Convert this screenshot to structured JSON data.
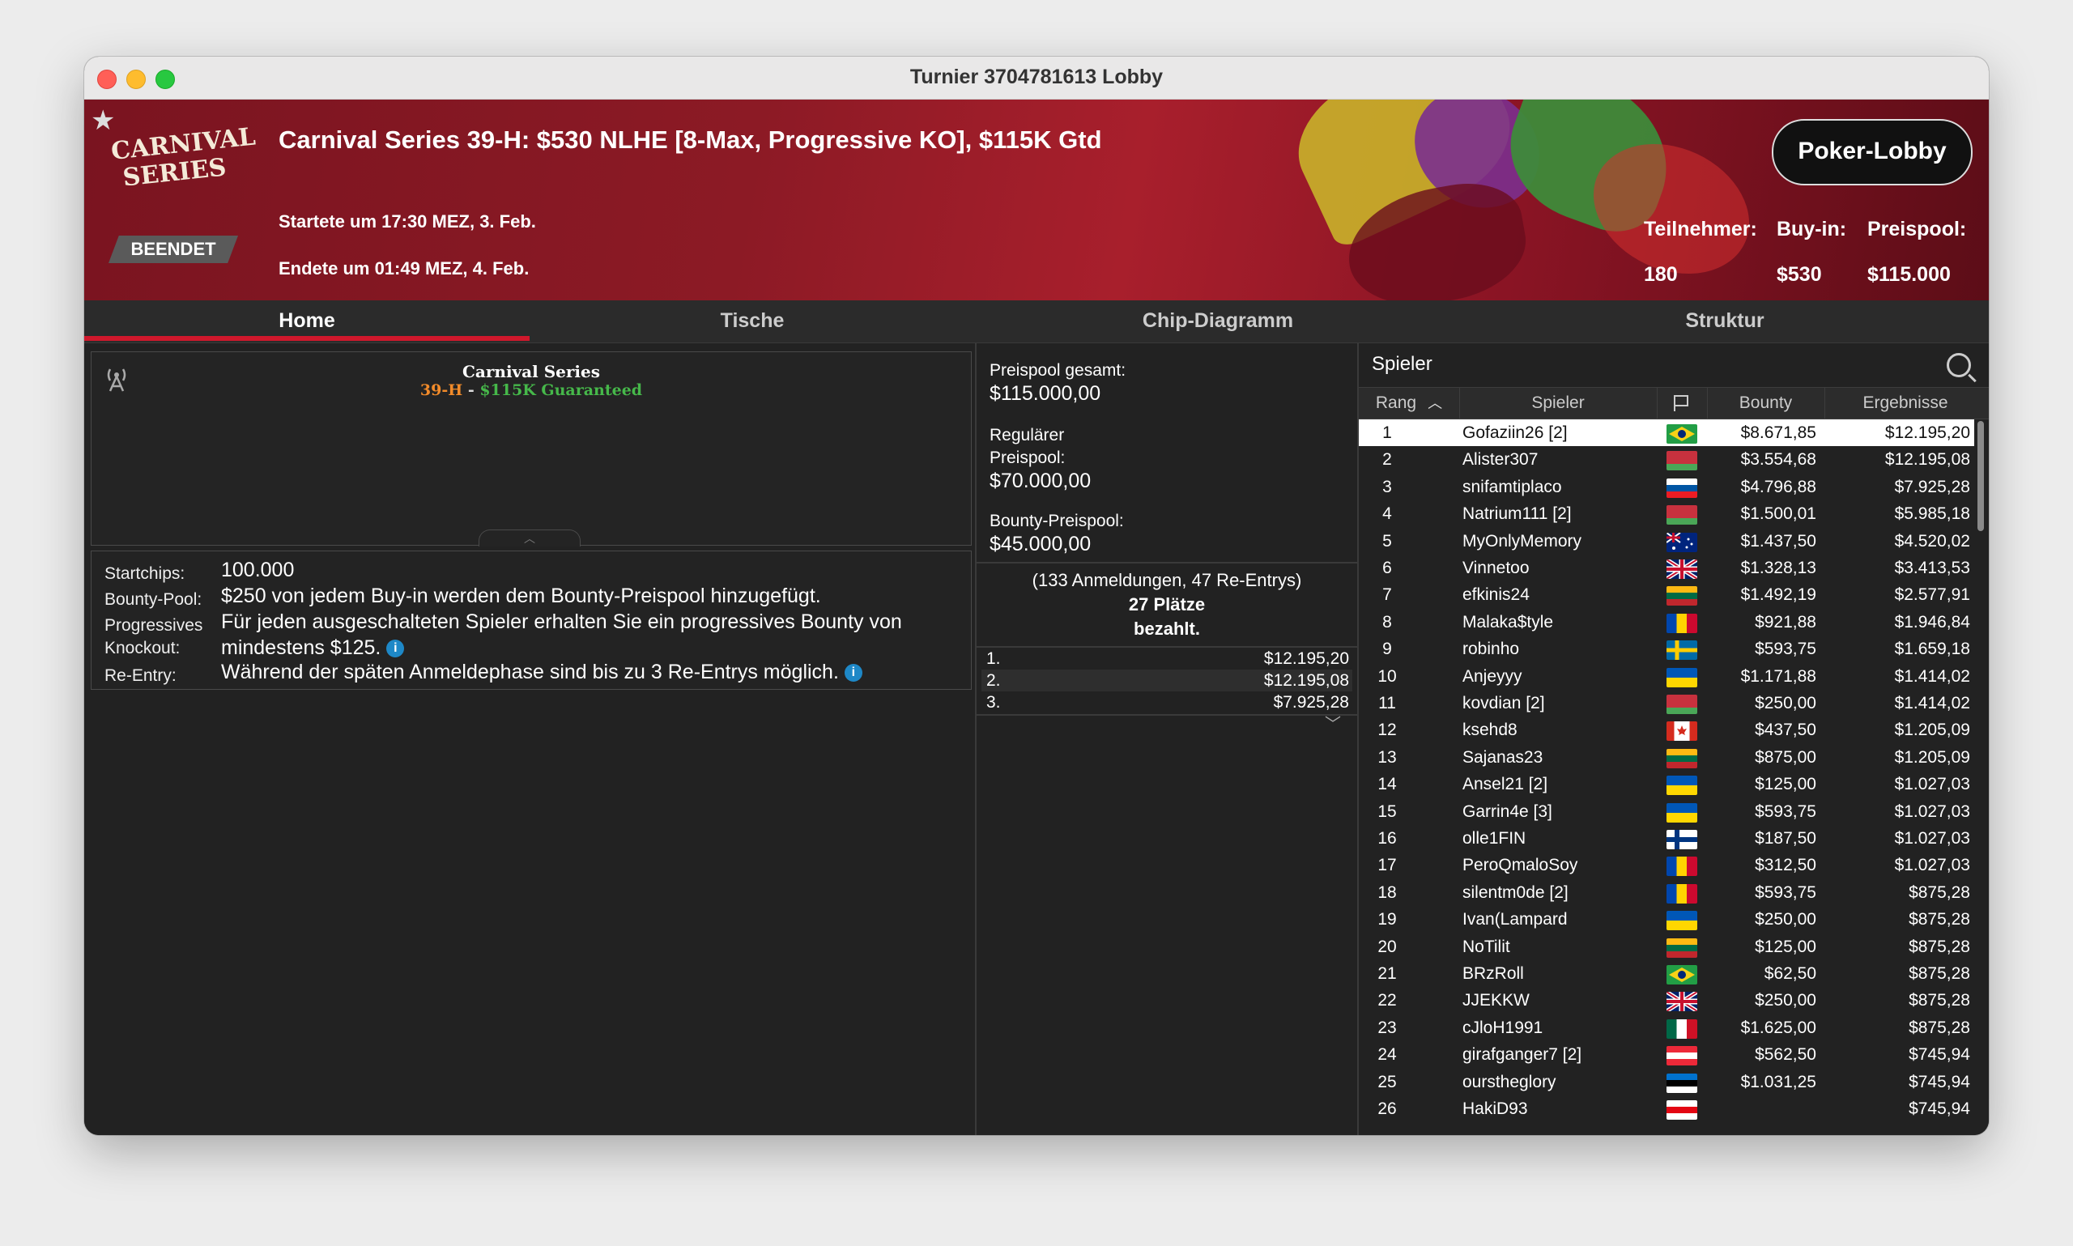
{
  "window": {
    "title": "Turnier 3704781613 Lobby"
  },
  "banner": {
    "logo_line1": "CARNIVAL",
    "logo_line2": "SERIES",
    "status": "BEENDET",
    "title": "Carnival Series 39-H: $530 NLHE [8-Max, Progressive KO], $115K Gtd",
    "started": "Startete um 17:30 MEZ, 3. Feb.",
    "ended": "Endete um 01:49 MEZ, 4. Feb.",
    "lobby_button": "Poker-Lobby",
    "stats": [
      {
        "label": "Teilnehmer:",
        "value": "180"
      },
      {
        "label": "Buy-in:",
        "value": "$530"
      },
      {
        "label": "Preispool:",
        "value": "$115.000"
      }
    ]
  },
  "tabs": [
    {
      "label": "Home",
      "active": true
    },
    {
      "label": "Tische",
      "active": false
    },
    {
      "label": "Chip-Diagramm",
      "active": false
    },
    {
      "label": "Struktur",
      "active": false
    }
  ],
  "home": {
    "banner_title": "Carnival Series",
    "banner_code": "39-H",
    "banner_sep": " - ",
    "banner_gtd": "$115K Guaranteed",
    "info": [
      {
        "label": "Startchips:",
        "value": "100.000"
      },
      {
        "label": "Bounty-Pool:",
        "value": "$250 von jedem Buy-in werden dem Bounty-Preispool hinzugefügt."
      },
      {
        "label": "Progressives Knockout:",
        "label1": "Progressives",
        "label2": "Knockout:",
        "value1": "Für jeden ausgeschalteten Spieler erhalten Sie ein progressives Bounty von",
        "value2": "mindestens $125."
      },
      {
        "label": "Re-Entry:",
        "value": "Während der späten Anmeldephase sind bis zu 3 Re-Entrys möglich."
      }
    ],
    "info_icon": "i"
  },
  "prizes": {
    "total_label": "Preispool gesamt:",
    "total_value": "$115.000,00",
    "regular_label1": "Regulärer",
    "regular_label2": "Preispool:",
    "regular_value": "$70.000,00",
    "bounty_label": "Bounty-Preispool:",
    "bounty_value": "$45.000,00",
    "entries": "(133 Anmeldungen, 47 Re-Entrys)",
    "places": "27 Plätze",
    "paid": "bezahlt.",
    "payouts": [
      {
        "place": "1.",
        "amount": "$12.195,20"
      },
      {
        "place": "2.",
        "amount": "$12.195,08"
      },
      {
        "place": "3.",
        "amount": "$7.925,28"
      }
    ]
  },
  "players": {
    "title": "Spieler",
    "columns": {
      "rank": "Rang",
      "player": "Spieler",
      "bounty": "Bounty",
      "results": "Ergebnisse"
    },
    "rows": [
      {
        "rank": "1",
        "name": "Gofaziin26 [2]",
        "flag": "brazil",
        "bounty": "$8.671,85",
        "result": "$12.195,20"
      },
      {
        "rank": "2",
        "name": "Alister307",
        "flag": "belarus",
        "bounty": "$3.554,68",
        "result": "$12.195,08"
      },
      {
        "rank": "3",
        "name": "snifamtiplaco",
        "flag": "slovenia",
        "bounty": "$4.796,88",
        "result": "$7.925,28"
      },
      {
        "rank": "4",
        "name": "Natrium111 [2]",
        "flag": "belarus",
        "bounty": "$1.500,01",
        "result": "$5.985,18"
      },
      {
        "rank": "5",
        "name": "MyOnlyMemory",
        "flag": "australia",
        "bounty": "$1.437,50",
        "result": "$4.520,02"
      },
      {
        "rank": "6",
        "name": "Vinnetoo",
        "flag": "uk",
        "bounty": "$1.328,13",
        "result": "$3.413,53"
      },
      {
        "rank": "7",
        "name": "efkinis24",
        "flag": "lithuania",
        "bounty": "$1.492,19",
        "result": "$2.577,91"
      },
      {
        "rank": "8",
        "name": "Malaka$tyle",
        "flag": "moldova",
        "bounty": "$921,88",
        "result": "$1.946,84"
      },
      {
        "rank": "9",
        "name": "robinho",
        "flag": "sweden",
        "bounty": "$593,75",
        "result": "$1.659,18"
      },
      {
        "rank": "10",
        "name": "Anjeyyy",
        "flag": "ukraine",
        "bounty": "$1.171,88",
        "result": "$1.414,02"
      },
      {
        "rank": "11",
        "name": "kovdian [2]",
        "flag": "belarus",
        "bounty": "$250,00",
        "result": "$1.414,02"
      },
      {
        "rank": "12",
        "name": "ksehd8",
        "flag": "canada",
        "bounty": "$437,50",
        "result": "$1.205,09"
      },
      {
        "rank": "13",
        "name": "Sajanas23",
        "flag": "lithuania",
        "bounty": "$875,00",
        "result": "$1.205,09"
      },
      {
        "rank": "14",
        "name": "Ansel21 [2]",
        "flag": "ukraine",
        "bounty": "$125,00",
        "result": "$1.027,03"
      },
      {
        "rank": "15",
        "name": "Garrin4e [3]",
        "flag": "ukraine",
        "bounty": "$593,75",
        "result": "$1.027,03"
      },
      {
        "rank": "16",
        "name": "olle1FIN",
        "flag": "finland",
        "bounty": "$187,50",
        "result": "$1.027,03"
      },
      {
        "rank": "17",
        "name": "PeroQmaloSoy",
        "flag": "moldova",
        "bounty": "$312,50",
        "result": "$1.027,03"
      },
      {
        "rank": "18",
        "name": "silentm0de [2]",
        "flag": "moldova",
        "bounty": "$593,75",
        "result": "$875,28"
      },
      {
        "rank": "19",
        "name": "Ivan(Lampard",
        "flag": "ukraine",
        "bounty": "$250,00",
        "result": "$875,28"
      },
      {
        "rank": "20",
        "name": "NoTilit",
        "flag": "lithuania",
        "bounty": "$125,00",
        "result": "$875,28"
      },
      {
        "rank": "21",
        "name": "BRzRoll",
        "flag": "brazil",
        "bounty": "$62,50",
        "result": "$875,28"
      },
      {
        "rank": "22",
        "name": "JJEKKW",
        "flag": "uk",
        "bounty": "$250,00",
        "result": "$875,28"
      },
      {
        "rank": "23",
        "name": "cJloH1991",
        "flag": "mexico",
        "bounty": "$1.625,00",
        "result": "$875,28"
      },
      {
        "rank": "24",
        "name": "girafganger7 [2]",
        "flag": "austria",
        "bounty": "$562,50",
        "result": "$745,94"
      },
      {
        "rank": "25",
        "name": "oursthеglory",
        "flag": "estonia",
        "bounty": "$1.031,25",
        "result": "$745,94"
      },
      {
        "rank": "26",
        "name": "HakiD93",
        "flag": "belarus-white",
        "bounty": "",
        "result": "$745,94"
      }
    ]
  },
  "colors": {
    "accent": "#d0182c",
    "selected_row": "#ffffff",
    "gtd_green": "#46b84a",
    "code_orange": "#f28b2a"
  }
}
